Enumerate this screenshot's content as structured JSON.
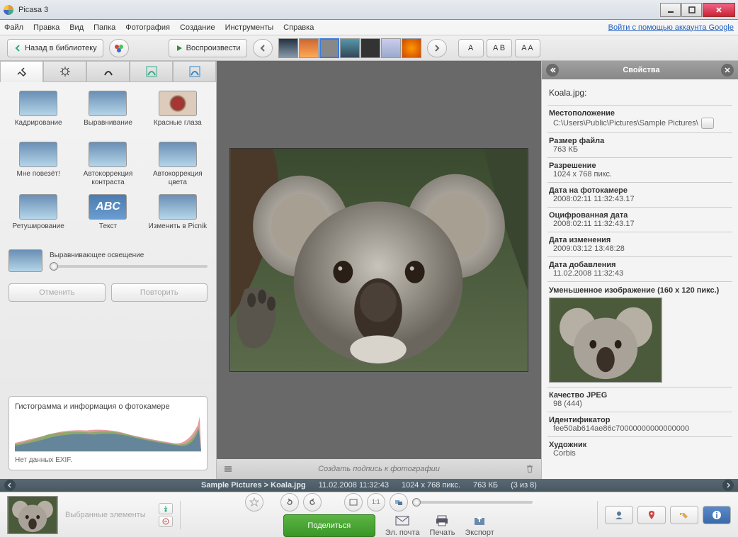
{
  "window": {
    "title": "Picasa 3"
  },
  "menu": {
    "items": [
      "Файл",
      "Правка",
      "Вид",
      "Папка",
      "Фотография",
      "Создание",
      "Инструменты",
      "Справка"
    ],
    "login": "Войти с помощью аккаунта Google"
  },
  "toolbar": {
    "back": "Назад в библиотеку",
    "play": "Воспроизвести",
    "viewA": "A",
    "viewAB": "A B",
    "viewAA": "A A"
  },
  "tabs": {
    "count": 5
  },
  "tools": [
    {
      "label": "Кадрирование"
    },
    {
      "label": "Выравнивание"
    },
    {
      "label": "Красные глаза"
    },
    {
      "label": "Мне повезёт!"
    },
    {
      "label": "Автокоррекция контраста"
    },
    {
      "label": "Автокоррекция цвета"
    },
    {
      "label": "Ретуширование"
    },
    {
      "label": "Текст"
    },
    {
      "label": "Изменить в Picnik"
    }
  ],
  "filllight": {
    "label": "Выравнивающее освещение"
  },
  "undo": "Отменить",
  "redo": "Повторить",
  "histogram": {
    "title": "Гистограмма и информация о фотокамере",
    "exif": "Нет данных EXIF."
  },
  "caption": {
    "placeholder": "Создать подпись к фотографии"
  },
  "properties": {
    "header": "Свойства",
    "filename": "Koala.jpg:",
    "rows": [
      {
        "k": "Местоположение",
        "v": "C:\\Users\\Public\\Pictures\\Sample Pictures\\",
        "path": true
      },
      {
        "k": "Размер файла",
        "v": "763 КБ"
      },
      {
        "k": "Разрешение",
        "v": "1024 x 768 пикс."
      },
      {
        "k": "Дата на фотокамере",
        "v": "2008:02:11 11:32:43.17"
      },
      {
        "k": "Оцифрованная дата",
        "v": "2008:02:11 11:32:43.17"
      },
      {
        "k": "Дата изменения",
        "v": "2009:03:12 13:48:28"
      },
      {
        "k": "Дата добавления",
        "v": "11.02.2008 11:32:43"
      }
    ],
    "thumbLabel": "Уменьшенное изображение (160 x 120 пикс.)",
    "rows2": [
      {
        "k": "Качество JPEG",
        "v": "98 (444)"
      },
      {
        "k": "Идентификатор",
        "v": "fee50ab614ae86c70000000000000000"
      },
      {
        "k": "Художник",
        "v": "Corbis"
      }
    ]
  },
  "status": {
    "path": "Sample Pictures > Koala.jpg",
    "date": "11.02.2008 11:32:43",
    "res": "1024 x 768 пикс.",
    "size": "763 КБ",
    "pos": "(3 из 8)"
  },
  "bottom": {
    "selected": "Выбранные элементы",
    "share": "Поделиться",
    "email": "Эл. почта",
    "print": "Печать",
    "export": "Экспорт"
  }
}
